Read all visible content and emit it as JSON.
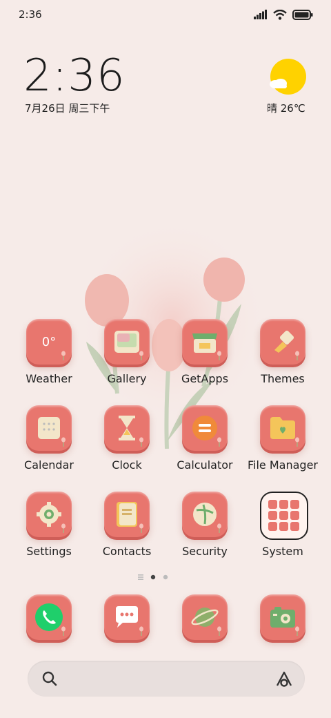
{
  "status_bar": {
    "time": "2:36"
  },
  "clock_widget": {
    "time": "2:36",
    "date": "7月26日 周三下午"
  },
  "weather_widget": {
    "text": "晴 26℃"
  },
  "home_apps": [
    {
      "label": "Weather",
      "icon": "weather-icon",
      "glyph": "0°"
    },
    {
      "label": "Gallery",
      "icon": "gallery-icon"
    },
    {
      "label": "GetApps",
      "icon": "getapps-icon"
    },
    {
      "label": "Themes",
      "icon": "themes-icon"
    },
    {
      "label": "Calendar",
      "icon": "calendar-icon"
    },
    {
      "label": "Clock",
      "icon": "clock-icon"
    },
    {
      "label": "Calculator",
      "icon": "calculator-icon"
    },
    {
      "label": "File Manager",
      "icon": "file-manager-icon"
    },
    {
      "label": "Settings",
      "icon": "settings-icon"
    },
    {
      "label": "Contacts",
      "icon": "contacts-icon"
    },
    {
      "label": "Security",
      "icon": "security-icon"
    },
    {
      "label": "System",
      "icon": "system-folder-icon"
    }
  ],
  "dock_apps": [
    {
      "icon": "phone-icon"
    },
    {
      "icon": "messages-icon"
    },
    {
      "icon": "browser-icon"
    },
    {
      "icon": "camera-icon"
    }
  ],
  "page_indicator": {
    "pages": 3,
    "current": 1
  },
  "colors": {
    "background": "#f6ebe8",
    "icon_base": "#e8766e",
    "sun": "#ffd200"
  }
}
